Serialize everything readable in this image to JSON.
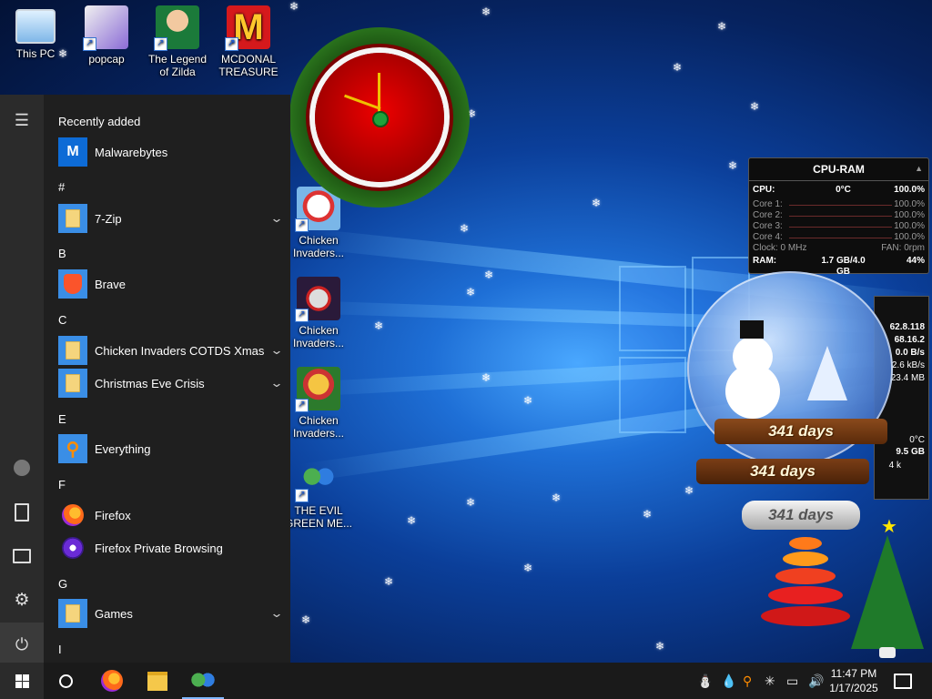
{
  "desktop": {
    "icons": [
      {
        "label": "This PC"
      },
      {
        "label": "popcap"
      },
      {
        "label": "The Legend of Zilda"
      },
      {
        "label": "MCDONAL TREASURE"
      },
      {
        "label": "Chicken Invaders..."
      },
      {
        "label": "Chicken Invaders..."
      },
      {
        "label": "Chicken Invaders..."
      },
      {
        "label": "THE EVIL GREEN ME..."
      }
    ]
  },
  "start_menu": {
    "recently_added": "Recently added",
    "sections": [
      {
        "letter": "#"
      },
      {
        "letter": "B"
      },
      {
        "letter": "C"
      },
      {
        "letter": "E"
      },
      {
        "letter": "F"
      },
      {
        "letter": "G"
      },
      {
        "letter": "I"
      }
    ],
    "apps": [
      {
        "name": "Malwarebytes",
        "icon": "malwarebytes-icon"
      },
      {
        "name": "7-Zip",
        "icon": "folder-icon",
        "expandable": true
      },
      {
        "name": "Brave",
        "icon": "brave-icon"
      },
      {
        "name": "Chicken Invaders COTDS Xmas",
        "icon": "folder-icon",
        "expandable": true
      },
      {
        "name": "Christmas Eve Crisis",
        "icon": "folder-icon",
        "expandable": true
      },
      {
        "name": "Everything",
        "icon": "everything-icon"
      },
      {
        "name": "Firefox",
        "icon": "firefox-icon"
      },
      {
        "name": "Firefox Private Browsing",
        "icon": "firefox-private-icon"
      },
      {
        "name": "Games",
        "icon": "folder-icon",
        "expandable": true
      }
    ],
    "rail": [
      "hamburger-icon",
      "user-icon",
      "document-icon",
      "pictures-icon",
      "settings-icon",
      "power-icon"
    ]
  },
  "cpu_ram": {
    "title": "CPU-RAM",
    "cpu_label": "CPU:",
    "cpu_temp": "0°C",
    "cpu_pct": "100.0%",
    "cores": [
      {
        "label": "Core 1:",
        "pct": "100.0%"
      },
      {
        "label": "Core 2:",
        "pct": "100.0%"
      },
      {
        "label": "Core 3:",
        "pct": "100.0%"
      },
      {
        "label": "Core 4:",
        "pct": "100.0%"
      }
    ],
    "clock_label": "Clock: 0 MHz",
    "fan_label": "FAN: 0rpm",
    "ram_label": "RAM:",
    "ram_value": "1.7 GB/4.0 GB",
    "ram_pct": "44%"
  },
  "net_gadget": {
    "values": [
      "62.8.118",
      "68.16.2",
      "0.0 B/s",
      "2.6 kB/s",
      "23.4 MB",
      "0°C",
      "9.5 GB",
      "4 k"
    ]
  },
  "snowglobe": {
    "plaque_top": "341 days",
    "plaque_mid": "341 days",
    "plaque_base": "341 days"
  },
  "taskbar": {
    "time": "11:47 PM",
    "date": "1/17/2025",
    "pinned": [
      "windows-start-icon",
      "search-icon",
      "firefox-icon",
      "file-explorer-icon",
      "messenger-icon"
    ]
  },
  "colors": {
    "accent_blue": "#3a8ee6",
    "start_bg": "#1f1f1f",
    "taskbar_bg": "#1a1a1a"
  }
}
